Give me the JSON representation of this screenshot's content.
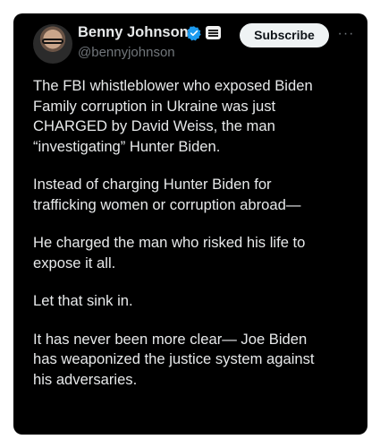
{
  "author": {
    "display_name": "Benny Johnson",
    "handle": "@bennyjohnson",
    "verified_color": "#1d9bf0"
  },
  "actions": {
    "subscribe_label": "Subscribe",
    "more_glyph": "···"
  },
  "icons": {
    "verified": "verified-badge-icon",
    "affiliate": "affiliate-badge-icon",
    "more": "more-options-icon"
  },
  "tweet": {
    "paragraphs": [
      "The FBI whistleblower who exposed Biden\nFamily corruption in Ukraine was just\nCHARGED by David Weiss, the man\n“investigating” Hunter Biden.",
      "Instead of charging Hunter Biden for\ntrafficking women or corruption abroad—",
      "He charged the man who risked his life to\nexpose it all.",
      "Let that sink in.",
      "It has never been more clear— Joe Biden\nhas weaponized the justice system against\nhis adversaries."
    ]
  }
}
